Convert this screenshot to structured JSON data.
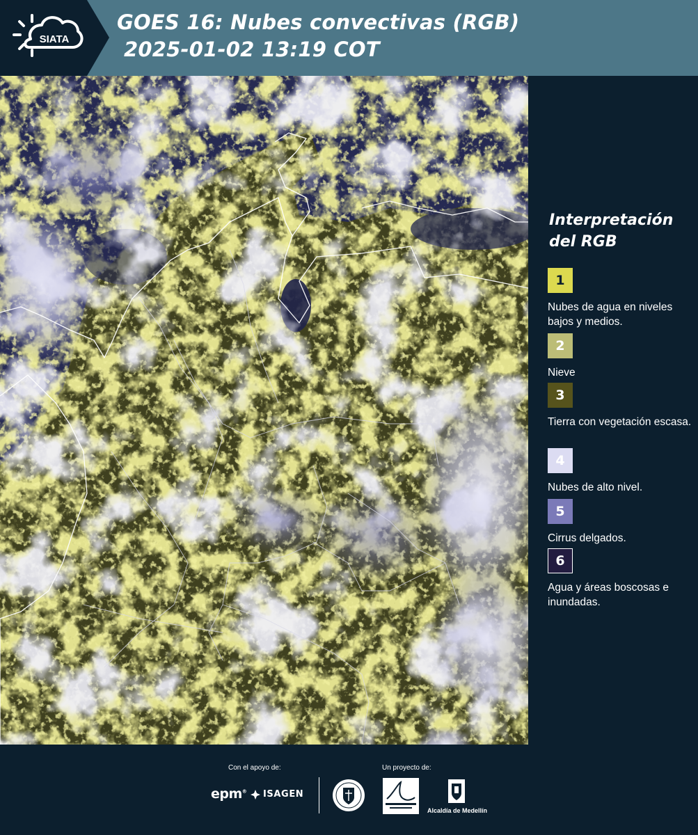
{
  "header": {
    "logo_text": "SIATA",
    "title_line1": "GOES 16: Nubes convectivas (RGB)",
    "title_line2": "2025-01-02 13:19 COT"
  },
  "legend": {
    "title": "Interpretación del RGB",
    "items": [
      {
        "number": "1",
        "label": "Nubes de agua en niveles bajos y medios.",
        "color": "#dcd94f",
        "text_color": "#0c1f2e"
      },
      {
        "number": "2",
        "label": "Nieve",
        "color": "#bcbd77",
        "text_color": "#ffffff"
      },
      {
        "number": "3",
        "label": "Tierra con vegetación escasa.",
        "color": "#56531c",
        "text_color": "#ffffff"
      },
      {
        "number": "4",
        "label": "Nubes de alto nivel.",
        "color": "#dcdcf2",
        "text_color": "#ffffff"
      },
      {
        "number": "5",
        "label": "Cirrus delgados.",
        "color": "#7b7ab8",
        "text_color": "#ffffff"
      },
      {
        "number": "6",
        "label": "Agua y áreas boscosas e inundadas.",
        "color": "#231c40",
        "text_color": "#ffffff"
      }
    ]
  },
  "footer": {
    "support_label": "Con el apoyo de:",
    "project_label": "Un proyecto de:",
    "logos": {
      "epm": "epm",
      "isagen": "ISAGEN",
      "area_metropolitana": "Área Metropolitana Valle de Aburrá",
      "medellin_seal": "Medellín",
      "alcaldia": "Alcaldía de Medellín"
    }
  },
  "colors": {
    "header_bg": "#4d7788",
    "panel_bg": "#0c1f2e",
    "map_ocean": "#262a52",
    "map_land": "#3e3f1e",
    "map_low_clouds": "#c8c64a",
    "map_high_clouds": "#dcdcf0"
  }
}
